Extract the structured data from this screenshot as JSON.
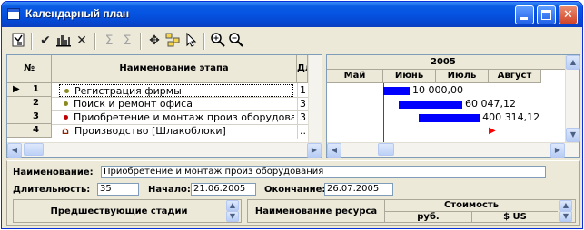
{
  "window": {
    "title": "Календарный план",
    "controls": {
      "minimize": "minimize",
      "maximize": "maximize",
      "close": "close"
    }
  },
  "toolbar": {
    "icons": [
      "properties-icon",
      "check-icon",
      "resources-icon",
      "delete-icon",
      "sum-icon",
      "sum-alt-icon",
      "add-stage-icon",
      "hierarchy-icon",
      "pointer-icon",
      "zoom-in-icon",
      "zoom-out-icon"
    ]
  },
  "grid": {
    "columns": {
      "num": "№",
      "name": "Наименование этапа",
      "duration": "Дли"
    },
    "rows": [
      {
        "num": "1",
        "name": "Регистрация фирмы",
        "duration": "1",
        "marker": "dot-olive",
        "current": true
      },
      {
        "num": "2",
        "name": "Поиск и ремонт офиса",
        "duration": "3",
        "marker": "dot-olive"
      },
      {
        "num": "3",
        "name": "Приобретение и монтаж произ оборудован",
        "duration": "3",
        "marker": "dot-red"
      },
      {
        "num": "4",
        "name": "Производство [Шлакоблоки]",
        "duration": "..",
        "marker": "production-icon"
      }
    ]
  },
  "gantt": {
    "year": "2005",
    "months": [
      "Май",
      "Июнь",
      "Июль",
      "Август"
    ],
    "bars": [
      {
        "start_month": 1.0,
        "end_month": 1.5,
        "cost": "10 000,00"
      },
      {
        "start_month": 1.3,
        "end_month": 2.5,
        "cost": "60 047,12"
      },
      {
        "start_month": 1.67,
        "end_month": 2.83,
        "cost": "400 314,12"
      }
    ],
    "milestone": {
      "month": 3.0,
      "color": "#ff0000"
    },
    "today_month": 1.0
  },
  "details": {
    "name_label": "Наименование:",
    "name_value": "Приобретение и монтаж произ оборудования",
    "duration_label": "Длительность:",
    "duration_value": "35",
    "start_label": "Начало:",
    "start_value": "21.06.2005",
    "end_label": "Окончание:",
    "end_value": "26.07.2005",
    "predecessors_header": "Предшествующие стадии",
    "resource_header": "Наименование ресурса",
    "cost_header": "Стоимость",
    "cost_rub": "руб.",
    "cost_usd": "$ US"
  },
  "colors": {
    "title_bar": "#0553e1",
    "gantt_bar": "#0000ff",
    "today_line": "#ff0000"
  }
}
